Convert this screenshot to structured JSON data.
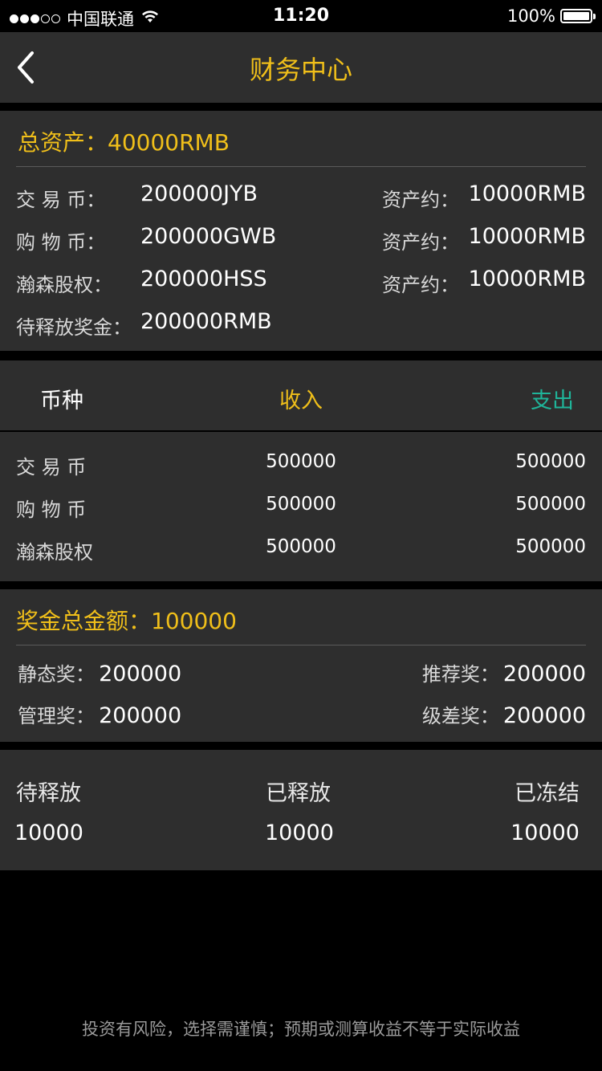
{
  "status_bar": {
    "carrier": "中国联通",
    "time": "11:20",
    "battery": "100%"
  },
  "nav": {
    "title": "财务中心"
  },
  "assets": {
    "total_label": "总资产：",
    "total_value": "40000RMB",
    "rows": [
      {
        "label": "交 易 币：",
        "amount": "200000JYB",
        "approx_label": "资产约：",
        "approx_value": "10000RMB"
      },
      {
        "label": "购 物 币：",
        "amount": "200000GWB",
        "approx_label": "资产约：",
        "approx_value": "10000RMB"
      },
      {
        "label": "瀚森股权：",
        "amount": "200000HSS",
        "approx_label": "资产约：",
        "approx_value": "10000RMB"
      },
      {
        "label": "待释放奖金：",
        "amount": "200000RMB"
      }
    ]
  },
  "currency_table": {
    "headers": {
      "currency": "币种",
      "income": "收入",
      "expense": "支出"
    },
    "rows": [
      {
        "name": "交 易 币",
        "income": "500000",
        "expense": "500000"
      },
      {
        "name": "购 物 币",
        "income": "500000",
        "expense": "500000"
      },
      {
        "name": "瀚森股权",
        "income": "500000",
        "expense": "500000"
      }
    ]
  },
  "bonus": {
    "total_label": "奖金总金额：",
    "total_value": "100000",
    "items": [
      {
        "label": "静态奖：",
        "value": "200000"
      },
      {
        "label": "推荐奖：",
        "value": "200000"
      },
      {
        "label": "管理奖：",
        "value": "200000"
      },
      {
        "label": "级差奖：",
        "value": "200000"
      }
    ]
  },
  "release": {
    "columns": [
      {
        "label": "待释放",
        "value": "10000"
      },
      {
        "label": "已释放",
        "value": "10000"
      },
      {
        "label": "已冻结",
        "value": "10000"
      }
    ]
  },
  "footer": {
    "disclaimer": "投资有风险，选择需谨慎；预期或测算收益不等于实际收益"
  },
  "colors": {
    "accent": "#f0bf1a",
    "expense": "#1fb59a",
    "panel": "#2e2e2e",
    "background": "#000000"
  }
}
